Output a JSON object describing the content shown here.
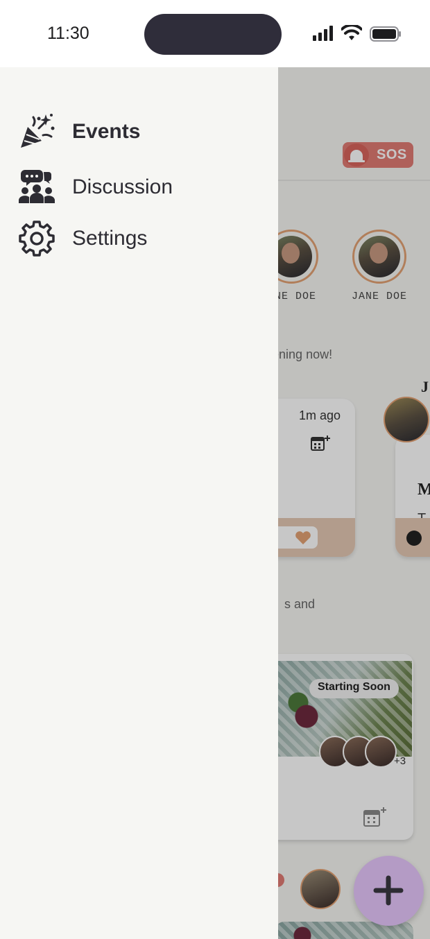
{
  "status_bar": {
    "time": "11:30"
  },
  "drawer": {
    "items": [
      {
        "label": "Events",
        "icon": "party-popper-icon",
        "active": true
      },
      {
        "label": "Discussion",
        "icon": "discussion-group-icon",
        "active": false
      },
      {
        "label": "Settings",
        "icon": "gear-icon",
        "active": false
      }
    ]
  },
  "background": {
    "sos_label": "SOS",
    "stories": [
      {
        "name": "NE DOE"
      },
      {
        "name": "JANE DOE"
      }
    ],
    "happening_text": "ppening now!",
    "event_card": {
      "time_ago": "1m ago",
      "heart_icon": "heart-icon",
      "calendar_icon": "calendar-add-icon"
    },
    "partial_card": {
      "title_initial": "M",
      "body_initial": "T",
      "author_initial": "J"
    },
    "section_text": "s and",
    "big_card": {
      "badge": "Starting Soon",
      "more_count": "+3"
    },
    "fab_icon": "plus-icon"
  },
  "colors": {
    "accent_orange": "#e3a274",
    "sos_red": "#e07b74",
    "fab_purple": "#b49bc5",
    "drawer_bg": "#f6f6f3",
    "card_footer": "#e5c8b4"
  }
}
